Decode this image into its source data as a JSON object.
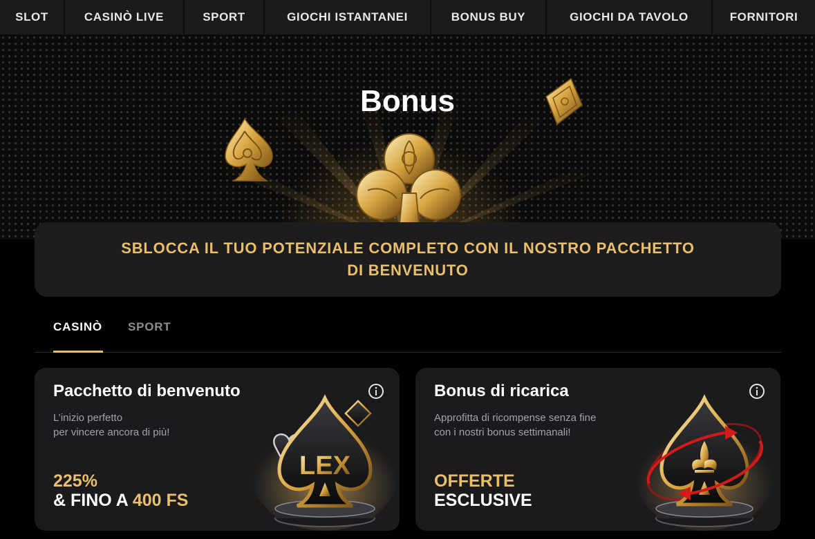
{
  "nav": {
    "items": [
      {
        "label": "SLOT"
      },
      {
        "label": "CASINÒ LIVE"
      },
      {
        "label": "SPORT"
      },
      {
        "label": "GIOCHI ISTANTANEI"
      },
      {
        "label": "BONUS BUY"
      },
      {
        "label": "GIOCHI DA TAVOLO"
      },
      {
        "label": "FORNITORI"
      }
    ]
  },
  "hero": {
    "title": "Bonus",
    "icons": [
      "spade-ornament",
      "club-ornament",
      "diamond-ornament"
    ]
  },
  "promo": {
    "text": "SBLOCCA IL TUO POTENZIALE COMPLETO CON IL NOSTRO PACCHETTO DI BENVENUTO"
  },
  "tabs": {
    "items": [
      {
        "label": "CASINÒ",
        "active": true
      },
      {
        "label": "SPORT",
        "active": false
      }
    ]
  },
  "cards": [
    {
      "title": "Pacchetto di benvenuto",
      "desc_line1": "L’inizio perfetto",
      "desc_line2": "per vincere ancora di più!",
      "offer_line1": "225%",
      "offer_prefix": "& FINO A ",
      "offer_highlight": "400 FS",
      "art_text": "LEX",
      "icon": "info-icon"
    },
    {
      "title": "Bonus di ricarica",
      "desc_line1": "Approfitta di ricompense senza fine",
      "desc_line2": "con i nostri bonus settimanali!",
      "offer_line1": "OFFERTE",
      "offer_line2": "ESCLUSIVE",
      "icon": "info-icon"
    }
  ],
  "colors": {
    "accent_gold": "#e9bf6c",
    "nav_bg": "#1b1b1d",
    "card_bg": "#1b1b1e",
    "accent_red": "#d41a1a"
  }
}
